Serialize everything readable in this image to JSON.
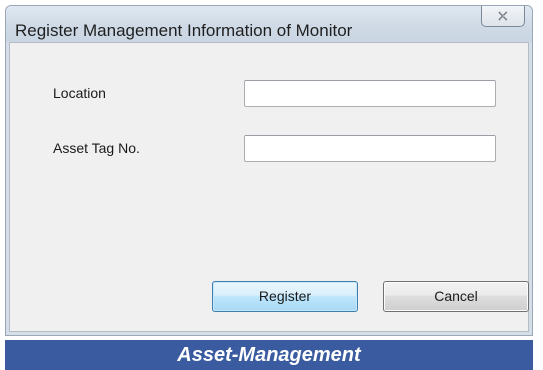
{
  "dialog": {
    "title": "Register Management Information of Monitor",
    "close_glyph": "☒"
  },
  "form": {
    "location": {
      "label": "Location",
      "value": "",
      "placeholder": ""
    },
    "asset_tag": {
      "label": "Asset Tag No.",
      "value": "",
      "placeholder": ""
    }
  },
  "buttons": {
    "register_label": "Register",
    "cancel_label": "Cancel"
  },
  "caption": {
    "text": "Asset-Management",
    "background": "#3a5ba0",
    "color": "#ffffff"
  },
  "icons": {
    "close": "close-icon"
  }
}
